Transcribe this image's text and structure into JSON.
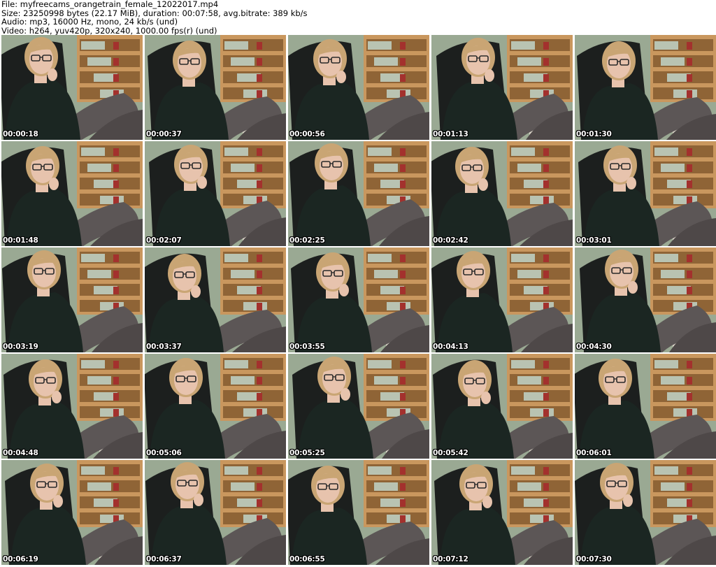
{
  "header": {
    "file_line": "File: myfreecams_orangetrain_female_12022017.mp4",
    "size_line": "Size: 23250998 bytes (22.17 MiB), duration: 00:07:58, avg.bitrate: 389 kb/s",
    "audio_line": "Audio: mp3, 16000 Hz, mono, 24 kb/s (und)",
    "video_line": "Video: h264, yuv420p, 320x240, 1000.00 fps(r) (und)"
  },
  "thumbnails": [
    {
      "timestamp": "00:00:18"
    },
    {
      "timestamp": "00:00:37"
    },
    {
      "timestamp": "00:00:56"
    },
    {
      "timestamp": "00:01:13"
    },
    {
      "timestamp": "00:01:30"
    },
    {
      "timestamp": "00:01:48"
    },
    {
      "timestamp": "00:02:07"
    },
    {
      "timestamp": "00:02:25"
    },
    {
      "timestamp": "00:02:42"
    },
    {
      "timestamp": "00:03:01"
    },
    {
      "timestamp": "00:03:19"
    },
    {
      "timestamp": "00:03:37"
    },
    {
      "timestamp": "00:03:55"
    },
    {
      "timestamp": "00:04:13"
    },
    {
      "timestamp": "00:04:30"
    },
    {
      "timestamp": "00:04:48"
    },
    {
      "timestamp": "00:05:06"
    },
    {
      "timestamp": "00:05:25"
    },
    {
      "timestamp": "00:05:42"
    },
    {
      "timestamp": "00:06:01"
    },
    {
      "timestamp": "00:06:19"
    },
    {
      "timestamp": "00:06:37"
    },
    {
      "timestamp": "00:06:55"
    },
    {
      "timestamp": "00:07:12"
    },
    {
      "timestamp": "00:07:30"
    }
  ],
  "colors": {
    "wall": "#9aa993",
    "shelf": "#c9975e",
    "shelf_dark": "#8f6436",
    "chair": "#1c1f1e",
    "shirt": "#1b2622",
    "skin": "#e7c3ad",
    "hair": "#c9a574",
    "tights": "#5c5656",
    "glasses": "#2a2a2a"
  }
}
